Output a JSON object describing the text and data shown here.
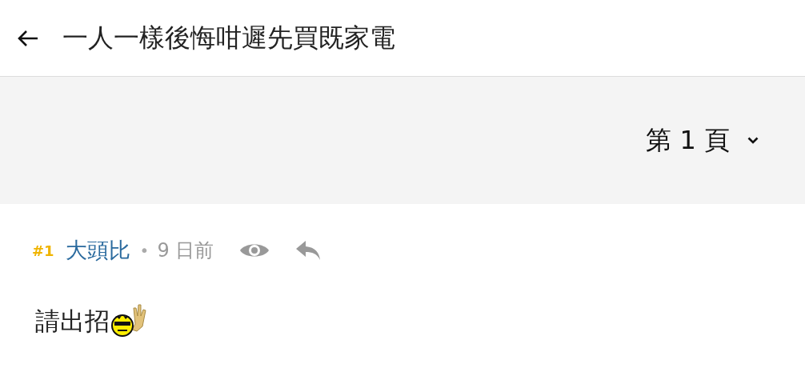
{
  "header": {
    "title": "一人一樣後悔咁遲先買既家電"
  },
  "pager": {
    "label": "第 1 頁"
  },
  "post": {
    "number": "#1",
    "author": "大頭比",
    "separator": "•",
    "time": "9 日前",
    "body": "請出招"
  }
}
